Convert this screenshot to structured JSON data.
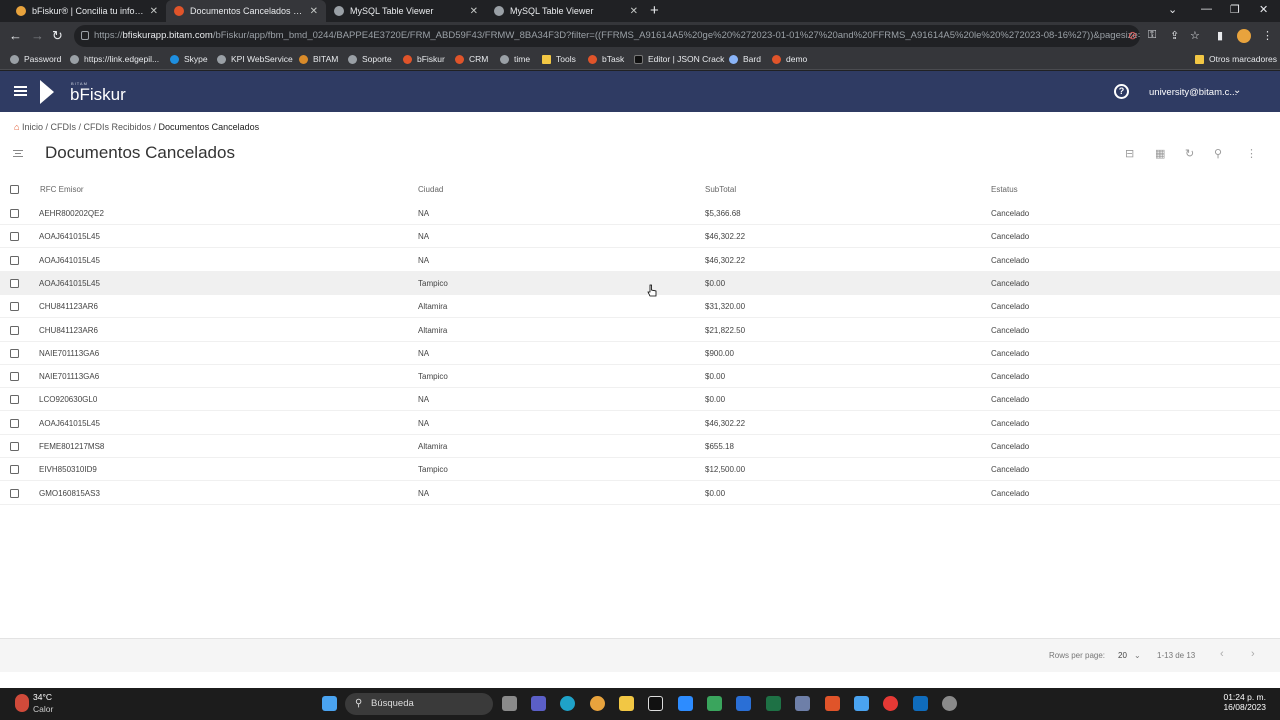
{
  "browser": {
    "tabs": [
      {
        "title": "bFiskur® | Concilia tu informació",
        "color": "#e8a33d"
      },
      {
        "title": "Documentos Cancelados - bFiscur",
        "color": "#e0542a"
      },
      {
        "title": "MySQL Table Viewer",
        "color": "#9aa0a6"
      },
      {
        "title": "MySQL Table Viewer",
        "color": "#9aa0a6"
      }
    ],
    "url_prefix": "https://",
    "url_host": "bfiskurapp.bitam.com",
    "url_path": "/bFiskur/app/fbm_bmd_0244/BAPPE4E3720E/FRM_ABD59F43/FRMW_8BA34F3D?filter=((FFRMS_A91614A5%20ge%20%272023-01-01%27%20and%20FFRMS_A91614A5%20le%20%272023-08-16%27))&pagesize=20&p...",
    "bookmarks": [
      {
        "label": "Password",
        "color": "#9aa0a6"
      },
      {
        "label": "https://link.edgepil...",
        "color": "#9aa0a6"
      },
      {
        "label": "Skype",
        "color": "#1e8fe0"
      },
      {
        "label": "KPI WebService",
        "color": "#9aa0a6"
      },
      {
        "label": "BITAM",
        "color": "#d98b2a"
      },
      {
        "label": "Soporte",
        "color": "#9aa0a6"
      },
      {
        "label": "bFiskur",
        "color": "#e0542a"
      },
      {
        "label": "CRM",
        "color": "#e0542a"
      },
      {
        "label": "time",
        "color": "#9aa0a6"
      },
      {
        "label": "Tools",
        "color": "#f2c744"
      },
      {
        "label": "bTask",
        "color": "#e0542a"
      },
      {
        "label": "Editor | JSON Crack",
        "color": "#111111"
      },
      {
        "label": "Bard",
        "color": "#8ab4f8"
      },
      {
        "label": "demo",
        "color": "#e0542a"
      }
    ],
    "other_bookmarks": "Otros marcadores"
  },
  "app": {
    "logo_sub": "BITAM",
    "logo_text": "bFiskur",
    "user": "university@bitam.c...",
    "breadcrumb": {
      "home": "Inicio",
      "sep": " / ",
      "cfdis": "CFDIs",
      "recibidos": "CFDIs Recibidos",
      "current": "Documentos Cancelados"
    },
    "page_title": "Documentos Cancelados",
    "columns": {
      "rfc": "RFC Emisor",
      "ciudad": "Ciudad",
      "subtotal": "SubTotal",
      "estatus": "Estatus"
    },
    "rows": [
      {
        "rfc": "AEHR800202QE2",
        "ciudad": "NA",
        "subtotal": "$5,366.68",
        "estatus": "Cancelado"
      },
      {
        "rfc": "AOAJ641015L45",
        "ciudad": "NA",
        "subtotal": "$46,302.22",
        "estatus": "Cancelado"
      },
      {
        "rfc": "AOAJ641015L45",
        "ciudad": "NA",
        "subtotal": "$46,302.22",
        "estatus": "Cancelado"
      },
      {
        "rfc": "AOAJ641015L45",
        "ciudad": "Tampico",
        "subtotal": "$0.00",
        "estatus": "Cancelado"
      },
      {
        "rfc": "CHU841123AR6",
        "ciudad": "Altamira",
        "subtotal": "$31,320.00",
        "estatus": "Cancelado"
      },
      {
        "rfc": "CHU841123AR6",
        "ciudad": "Altamira",
        "subtotal": "$21,822.50",
        "estatus": "Cancelado"
      },
      {
        "rfc": "NAIE701113GA6",
        "ciudad": "NA",
        "subtotal": "$900.00",
        "estatus": "Cancelado"
      },
      {
        "rfc": "NAIE701113GA6",
        "ciudad": "Tampico",
        "subtotal": "$0.00",
        "estatus": "Cancelado"
      },
      {
        "rfc": "LCO920630GL0",
        "ciudad": "NA",
        "subtotal": "$0.00",
        "estatus": "Cancelado"
      },
      {
        "rfc": "AOAJ641015L45",
        "ciudad": "NA",
        "subtotal": "$46,302.22",
        "estatus": "Cancelado"
      },
      {
        "rfc": "FEME801217MS8",
        "ciudad": "Altamira",
        "subtotal": "$655.18",
        "estatus": "Cancelado"
      },
      {
        "rfc": "EIVH850310ID9",
        "ciudad": "Tampico",
        "subtotal": "$12,500.00",
        "estatus": "Cancelado"
      },
      {
        "rfc": "GMO160815AS3",
        "ciudad": "NA",
        "subtotal": "$0.00",
        "estatus": "Cancelado"
      }
    ],
    "footer": {
      "rows_per_page_label": "Rows per page:",
      "rows_per_page": "20",
      "range": "1-13 de 13"
    }
  },
  "taskbar": {
    "temp": "34°C",
    "condition": "Calor",
    "search": "Búsqueda",
    "time": "01:24 p. m.",
    "date": "16/08/2023"
  }
}
